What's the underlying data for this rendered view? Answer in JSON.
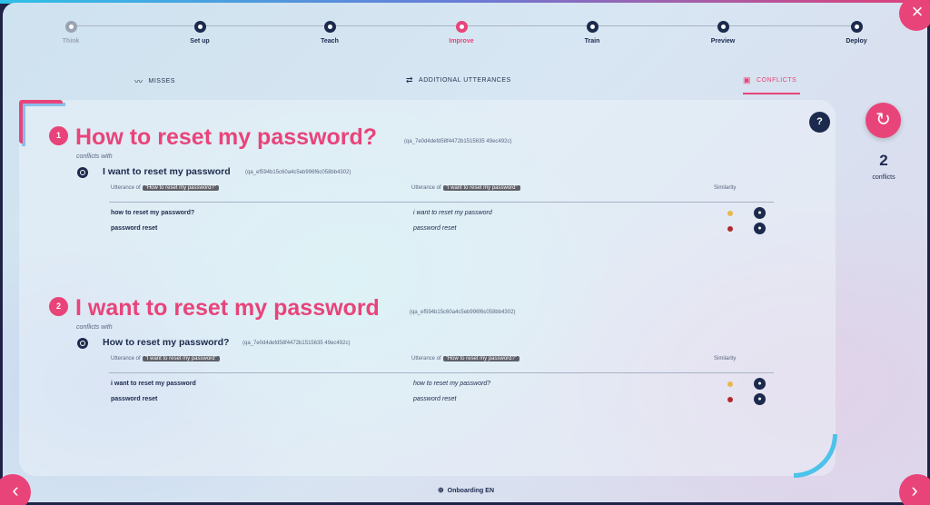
{
  "stepper": {
    "steps": [
      {
        "label": "Think",
        "state": "done"
      },
      {
        "label": "Set up",
        "state": "normal"
      },
      {
        "label": "Teach",
        "state": "normal"
      },
      {
        "label": "Improve",
        "state": "active"
      },
      {
        "label": "Train",
        "state": "normal"
      },
      {
        "label": "Preview",
        "state": "normal"
      },
      {
        "label": "Deploy",
        "state": "normal"
      }
    ]
  },
  "tabs": {
    "misses": "MISSES",
    "additional": "ADDITIONAL UTTERANCES",
    "conflicts": "CONFLICTS"
  },
  "side": {
    "count": "2",
    "count_label": "conflicts"
  },
  "conflicts": [
    {
      "number": "1",
      "title": "How to reset my password?",
      "id": "(qa_7e0d4defd58f4472b1515635 49ec492c)",
      "conflicts_with_label": "conflicts with",
      "with_title": "I want to reset my password",
      "with_id": "(qa_ef594b15c60a4c5eb996f6c058bb4302)",
      "col1_label": "Utterance of",
      "col1_tag": "\"How to reset my password?\"",
      "col2_label": "Utterance of",
      "col2_tag": "\"I want to reset my password\"",
      "col3_label": "Similarity",
      "rows": [
        {
          "left": "how to reset my password?",
          "right": "i want to reset my password",
          "similarity": "medium"
        },
        {
          "left": "password reset",
          "right": "password reset",
          "similarity": "high"
        }
      ]
    },
    {
      "number": "2",
      "title": "I want to reset my password",
      "id": "(qa_ef594b15c60a4c5eb996f6c058bb4302)",
      "conflicts_with_label": "conflicts with",
      "with_title": "How to reset my password?",
      "with_id": "(qa_7e0d4defd58f4472b1515635 49ec492c)",
      "col1_label": "Utterance of",
      "col1_tag": "\"I want to reset my password\"",
      "col2_label": "Utterance of",
      "col2_tag": "\"How to reset my password?\"",
      "col3_label": "Similarity",
      "rows": [
        {
          "left": "i want to reset my password",
          "right": "how to reset my password?",
          "similarity": "medium"
        },
        {
          "left": "password reset",
          "right": "password reset",
          "similarity": "high"
        }
      ]
    }
  ],
  "footer": {
    "label": "Onboarding EN"
  },
  "colors": {
    "accent": "#e8447a",
    "navy": "#1c2a4d",
    "similarity_medium": "#e8b84a",
    "similarity_high": "#b3282d"
  }
}
